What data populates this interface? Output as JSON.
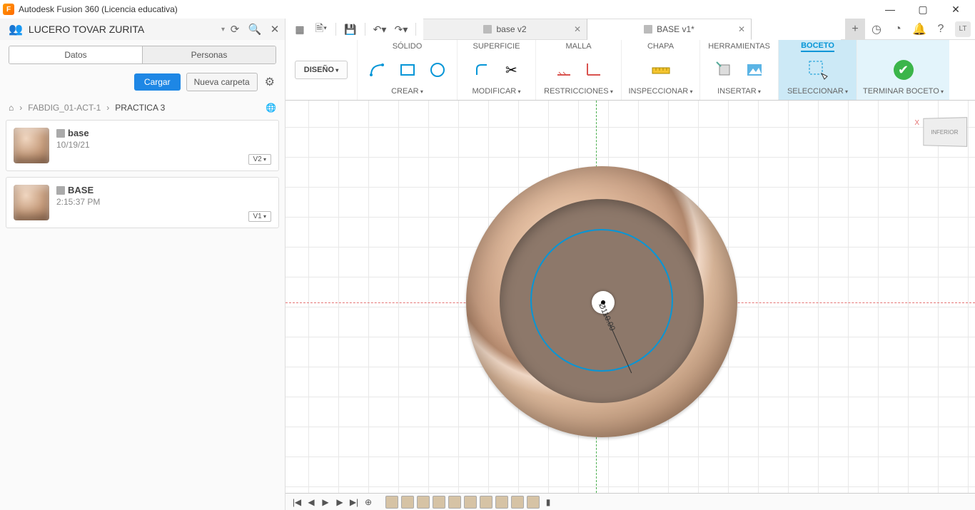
{
  "app": {
    "title": "Autodesk Fusion 360 (Licencia educativa)",
    "logo_letter": "F"
  },
  "user": {
    "name": "LUCERO TOVAR ZURITA",
    "initials": "LT"
  },
  "doc_tabs": [
    {
      "label": "base v2",
      "active": false
    },
    {
      "label": "BASE v1*",
      "active": true
    }
  ],
  "side_tabs": {
    "datos": "Datos",
    "personas": "Personas"
  },
  "side_actions": {
    "cargar": "Cargar",
    "nueva": "Nueva carpeta"
  },
  "breadcrumb": {
    "a": "FABDIG_01-ACT-1",
    "b": "PRACTICA 3"
  },
  "items": [
    {
      "name": "base",
      "date": "10/19/21",
      "ver": "V2"
    },
    {
      "name": "BASE",
      "date": "2:15:37 PM",
      "ver": "V1"
    }
  ],
  "workspace": "DISEÑO",
  "ribbon_tabs": {
    "solido": "SÓLIDO",
    "superficie": "SUPERFICIE",
    "malla": "MALLA",
    "chapa": "CHAPA",
    "herr": "HERRAMIENTAS",
    "boceto": "BOCETO"
  },
  "ribbon_groups": {
    "crear": "CREAR",
    "modificar": "MODIFICAR",
    "restricciones": "RESTRICCIONES",
    "inspeccionar": "INSPECCIONAR",
    "insertar": "INSERTAR",
    "seleccionar": "SELECCIONAR",
    "terminar": "TERMINAR BOCETO"
  },
  "viewcube": "INFERIOR",
  "axis_x": "X",
  "dimension": "Ø110.00"
}
